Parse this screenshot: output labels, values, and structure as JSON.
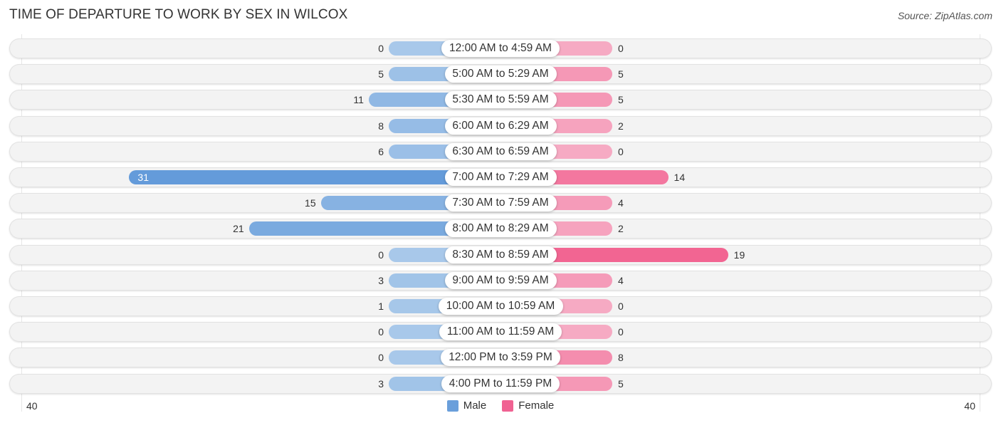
{
  "header": {
    "title": "TIME OF DEPARTURE TO WORK BY SEX IN WILCOX",
    "source": "Source: ZipAtlas.com"
  },
  "chart_data": {
    "type": "bar",
    "orientation": "horizontal-diverging",
    "title": "TIME OF DEPARTURE TO WORK BY SEX IN WILCOX",
    "categories": [
      "12:00 AM to 4:59 AM",
      "5:00 AM to 5:29 AM",
      "5:30 AM to 5:59 AM",
      "6:00 AM to 6:29 AM",
      "6:30 AM to 6:59 AM",
      "7:00 AM to 7:29 AM",
      "7:30 AM to 7:59 AM",
      "8:00 AM to 8:29 AM",
      "8:30 AM to 8:59 AM",
      "9:00 AM to 9:59 AM",
      "10:00 AM to 10:59 AM",
      "11:00 AM to 11:59 AM",
      "12:00 PM to 3:59 PM",
      "4:00 PM to 11:59 PM"
    ],
    "series": [
      {
        "name": "Male",
        "color": "#6a9fdb",
        "values": [
          0,
          5,
          11,
          8,
          6,
          31,
          15,
          21,
          0,
          3,
          1,
          0,
          0,
          3
        ]
      },
      {
        "name": "Female",
        "color": "#f06292",
        "values": [
          0,
          5,
          5,
          2,
          0,
          14,
          4,
          2,
          19,
          4,
          0,
          0,
          8,
          5
        ]
      }
    ],
    "xlim": [
      -40,
      40
    ],
    "axis_tick_labels": {
      "left": "40",
      "right": "40"
    },
    "legend": {
      "position": "bottom-center",
      "entries": [
        "Male",
        "Female"
      ]
    },
    "grid": false
  },
  "legend": {
    "male_label": "Male",
    "female_label": "Female",
    "male_color": "#6a9fdb",
    "female_color": "#f06292"
  },
  "axis": {
    "left_label": "40",
    "right_label": "40"
  }
}
